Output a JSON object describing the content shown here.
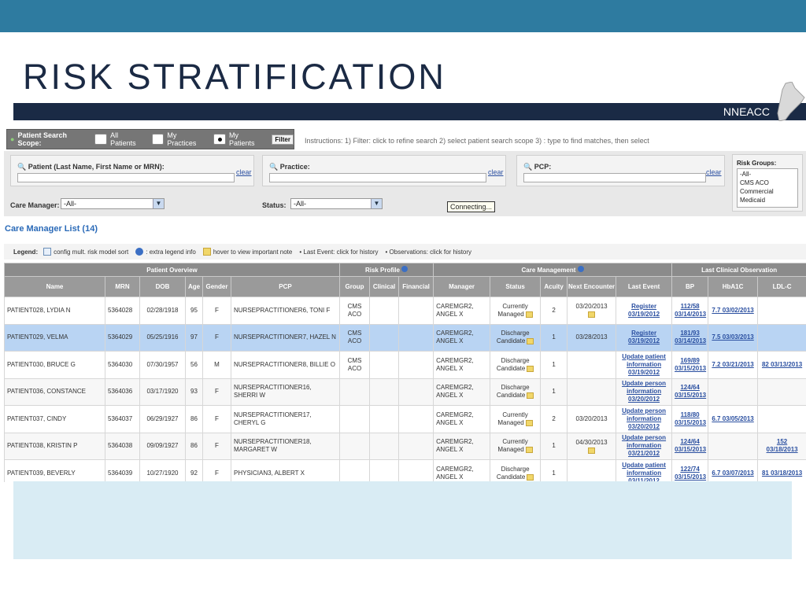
{
  "slide": {
    "title": "RISK STRATIFICATION",
    "banner_label": "NNEACC"
  },
  "scope": {
    "label": "Patient Search Scope:",
    "options": [
      "All Patients",
      "My Practices",
      "My Patients"
    ],
    "selected": "My Patients",
    "filter_label": "Filter"
  },
  "instructions": "Instructions: 1) Filter: click to refine search 2) select patient search scope 3) : type to find matches, then select",
  "filters": {
    "patient_label": "Patient (Last Name, First Name or MRN):",
    "practice_label": "Practice:",
    "pcp_label": "PCP:",
    "clear_label": "clear",
    "care_manager_label": "Care Manager:",
    "care_manager_value": "-All-",
    "status_label": "Status:",
    "status_value": "-All-",
    "risk_groups_label": "Risk Groups:",
    "risk_groups": [
      "-All-",
      "CMS ACO",
      "Commercial",
      "Medicaid"
    ],
    "tooltip": "Connecting..."
  },
  "list_title": "Care Manager List (14)",
  "legend": {
    "label": "Legend:",
    "items": [
      "config mult. risk model sort",
      ": extra legend info",
      "hover to view important note",
      "• Last Event: click for history",
      "• Observations: click for history"
    ]
  },
  "table": {
    "groups": [
      "Patient Overview",
      "Risk Profile",
      "Care Management",
      "Last Clinical Observation"
    ],
    "columns": [
      "Name",
      "MRN",
      "DOB",
      "Age",
      "Gender",
      "PCP",
      "Group",
      "Clinical",
      "Financial",
      "Manager",
      "Status",
      "Acuity",
      "Next Encounter",
      "Last Event",
      "BP",
      "HbA1C",
      "LDL-C"
    ],
    "rows": [
      {
        "name": "PATIENT028, LYDIA N",
        "mrn": "5364028",
        "dob": "02/28/1918",
        "age": "95",
        "gender": "F",
        "pcp": "NURSEPRACTITIONER6, TONI F",
        "group": "CMS ACO",
        "manager": "CAREMGR2, ANGEL X",
        "status": "Currently Managed",
        "acuity": "2",
        "next": "03/20/2013",
        "event": "Register 03/19/2012",
        "bp": "112/58 03/14/2013",
        "hba1c": "7.7 03/02/2013",
        "ldl": ""
      },
      {
        "name": "PATIENT029, VELMA",
        "mrn": "5364029",
        "dob": "05/25/1916",
        "age": "97",
        "gender": "F",
        "pcp": "NURSEPRACTITIONER7, HAZEL N",
        "group": "CMS ACO",
        "manager": "CAREMGR2, ANGEL X",
        "status": "Discharge Candidate",
        "acuity": "1",
        "next": "03/28/2013",
        "event": "Register 03/19/2012",
        "bp": "181/93 03/14/2013",
        "hba1c": "7.5 03/03/2013",
        "ldl": ""
      },
      {
        "name": "PATIENT030, BRUCE G",
        "mrn": "5364030",
        "dob": "07/30/1957",
        "age": "56",
        "gender": "M",
        "pcp": "NURSEPRACTITIONER8, BILLIE O",
        "group": "CMS ACO",
        "manager": "CAREMGR2, ANGEL X",
        "status": "Discharge Candidate",
        "acuity": "1",
        "next": "",
        "event": "Update patient information 03/19/2012",
        "bp": "169/89 03/15/2013",
        "hba1c": "7.2 03/21/2013",
        "ldl": "82 03/13/2013"
      },
      {
        "name": "PATIENT036, CONSTANCE",
        "mrn": "5364036",
        "dob": "03/17/1920",
        "age": "93",
        "gender": "F",
        "pcp": "NURSEPRACTITIONER16, SHERRI W",
        "group": "",
        "manager": "CAREMGR2, ANGEL X",
        "status": "Discharge Candidate",
        "acuity": "1",
        "next": "",
        "event": "Update person information 03/20/2012",
        "bp": "124/64 03/15/2013",
        "hba1c": "",
        "ldl": ""
      },
      {
        "name": "PATIENT037, CINDY",
        "mrn": "5364037",
        "dob": "06/29/1927",
        "age": "86",
        "gender": "F",
        "pcp": "NURSEPRACTITIONER17, CHERYL G",
        "group": "",
        "manager": "CAREMGR2, ANGEL X",
        "status": "Currently Managed",
        "acuity": "2",
        "next": "03/20/2013",
        "event": "Update person information 03/20/2012",
        "bp": "118/80 03/15/2013",
        "hba1c": "6.7 03/05/2013",
        "ldl": ""
      },
      {
        "name": "PATIENT038, KRISTIN P",
        "mrn": "5364038",
        "dob": "09/09/1927",
        "age": "86",
        "gender": "F",
        "pcp": "NURSEPRACTITIONER18, MARGARET W",
        "group": "",
        "manager": "CAREMGR2, ANGEL X",
        "status": "Currently Managed",
        "acuity": "1",
        "next": "04/30/2013",
        "event": "Update person information 03/21/2012",
        "bp": "124/64 03/15/2013",
        "hba1c": "",
        "ldl": "152 03/18/2013"
      },
      {
        "name": "PATIENT039, BEVERLY",
        "mrn": "5364039",
        "dob": "10/27/1920",
        "age": "92",
        "gender": "F",
        "pcp": "PHYSICIAN3, ALBERT X",
        "group": "",
        "manager": "CAREMGR2, ANGEL X",
        "status": "Discharge Candidate",
        "acuity": "1",
        "next": "",
        "event": "Update patient information 03/11/2012",
        "bp": "122/74 03/15/2013",
        "hba1c": "6.7 03/07/2013",
        "ldl": "81 03/18/2013"
      }
    ]
  }
}
